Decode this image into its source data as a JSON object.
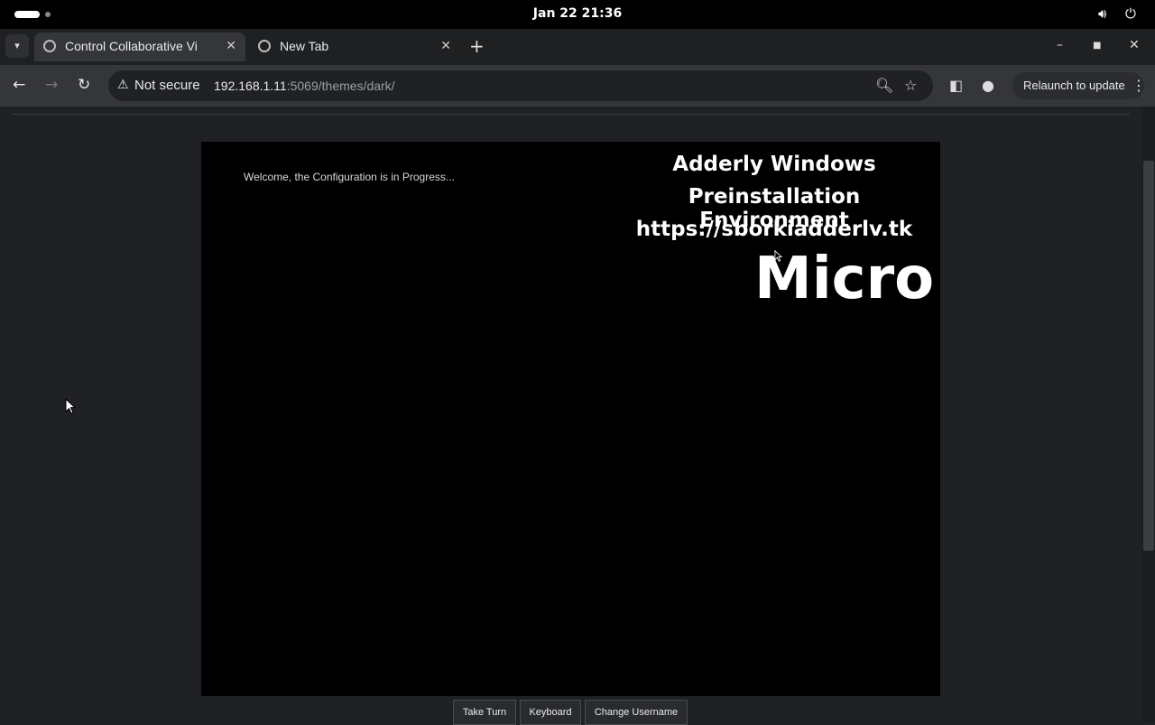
{
  "system_bar": {
    "clock": "Jan 22  21:36"
  },
  "tabs": [
    {
      "title": "Control Collaborative Vi",
      "active": true
    },
    {
      "title": "New Tab",
      "active": false
    }
  ],
  "toolbar": {
    "security_label": "Not secure",
    "url_host": "192.168.1.11",
    "url_rest": ":5069/themes/dark/",
    "relaunch_label": "Relaunch to update"
  },
  "remote_screen": {
    "welcome_text": "Welcome, the Configuration is in Progress...",
    "watermark_line1": "Adderly Windows",
    "watermark_line2": "Preinstallation Environment",
    "watermark_line3": "https://sborkiadderlv.tk",
    "big_text": "Micro"
  },
  "controls": {
    "take_turn": "Take Turn",
    "keyboard": "Keyboard",
    "change_username": "Change Username"
  },
  "colors": {
    "page_bg": "#202124",
    "toolbar_bg": "#35363a",
    "screen_bg": "#000000"
  }
}
